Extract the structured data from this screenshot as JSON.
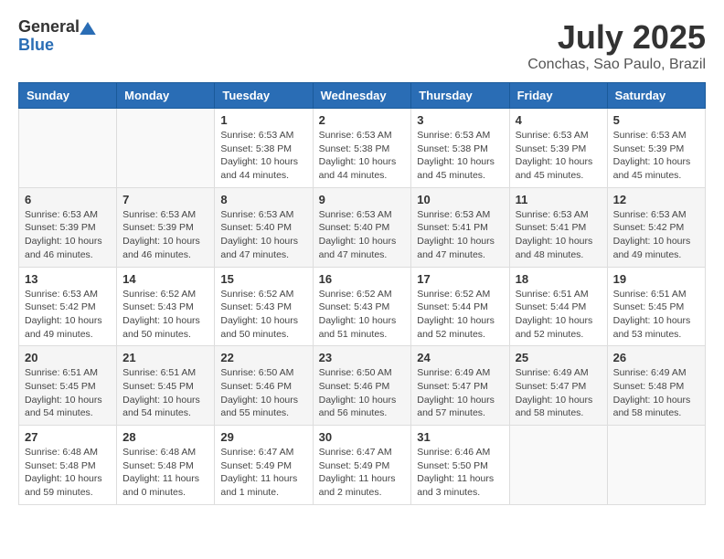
{
  "logo": {
    "general": "General",
    "blue": "Blue"
  },
  "title": {
    "month": "July 2025",
    "location": "Conchas, Sao Paulo, Brazil"
  },
  "weekdays": [
    "Sunday",
    "Monday",
    "Tuesday",
    "Wednesday",
    "Thursday",
    "Friday",
    "Saturday"
  ],
  "weeks": [
    [
      {
        "day": "",
        "info": ""
      },
      {
        "day": "",
        "info": ""
      },
      {
        "day": "1",
        "info": "Sunrise: 6:53 AM\nSunset: 5:38 PM\nDaylight: 10 hours and 44 minutes."
      },
      {
        "day": "2",
        "info": "Sunrise: 6:53 AM\nSunset: 5:38 PM\nDaylight: 10 hours and 44 minutes."
      },
      {
        "day": "3",
        "info": "Sunrise: 6:53 AM\nSunset: 5:38 PM\nDaylight: 10 hours and 45 minutes."
      },
      {
        "day": "4",
        "info": "Sunrise: 6:53 AM\nSunset: 5:39 PM\nDaylight: 10 hours and 45 minutes."
      },
      {
        "day": "5",
        "info": "Sunrise: 6:53 AM\nSunset: 5:39 PM\nDaylight: 10 hours and 45 minutes."
      }
    ],
    [
      {
        "day": "6",
        "info": "Sunrise: 6:53 AM\nSunset: 5:39 PM\nDaylight: 10 hours and 46 minutes."
      },
      {
        "day": "7",
        "info": "Sunrise: 6:53 AM\nSunset: 5:39 PM\nDaylight: 10 hours and 46 minutes."
      },
      {
        "day": "8",
        "info": "Sunrise: 6:53 AM\nSunset: 5:40 PM\nDaylight: 10 hours and 47 minutes."
      },
      {
        "day": "9",
        "info": "Sunrise: 6:53 AM\nSunset: 5:40 PM\nDaylight: 10 hours and 47 minutes."
      },
      {
        "day": "10",
        "info": "Sunrise: 6:53 AM\nSunset: 5:41 PM\nDaylight: 10 hours and 47 minutes."
      },
      {
        "day": "11",
        "info": "Sunrise: 6:53 AM\nSunset: 5:41 PM\nDaylight: 10 hours and 48 minutes."
      },
      {
        "day": "12",
        "info": "Sunrise: 6:53 AM\nSunset: 5:42 PM\nDaylight: 10 hours and 49 minutes."
      }
    ],
    [
      {
        "day": "13",
        "info": "Sunrise: 6:53 AM\nSunset: 5:42 PM\nDaylight: 10 hours and 49 minutes."
      },
      {
        "day": "14",
        "info": "Sunrise: 6:52 AM\nSunset: 5:43 PM\nDaylight: 10 hours and 50 minutes."
      },
      {
        "day": "15",
        "info": "Sunrise: 6:52 AM\nSunset: 5:43 PM\nDaylight: 10 hours and 50 minutes."
      },
      {
        "day": "16",
        "info": "Sunrise: 6:52 AM\nSunset: 5:43 PM\nDaylight: 10 hours and 51 minutes."
      },
      {
        "day": "17",
        "info": "Sunrise: 6:52 AM\nSunset: 5:44 PM\nDaylight: 10 hours and 52 minutes."
      },
      {
        "day": "18",
        "info": "Sunrise: 6:51 AM\nSunset: 5:44 PM\nDaylight: 10 hours and 52 minutes."
      },
      {
        "day": "19",
        "info": "Sunrise: 6:51 AM\nSunset: 5:45 PM\nDaylight: 10 hours and 53 minutes."
      }
    ],
    [
      {
        "day": "20",
        "info": "Sunrise: 6:51 AM\nSunset: 5:45 PM\nDaylight: 10 hours and 54 minutes."
      },
      {
        "day": "21",
        "info": "Sunrise: 6:51 AM\nSunset: 5:45 PM\nDaylight: 10 hours and 54 minutes."
      },
      {
        "day": "22",
        "info": "Sunrise: 6:50 AM\nSunset: 5:46 PM\nDaylight: 10 hours and 55 minutes."
      },
      {
        "day": "23",
        "info": "Sunrise: 6:50 AM\nSunset: 5:46 PM\nDaylight: 10 hours and 56 minutes."
      },
      {
        "day": "24",
        "info": "Sunrise: 6:49 AM\nSunset: 5:47 PM\nDaylight: 10 hours and 57 minutes."
      },
      {
        "day": "25",
        "info": "Sunrise: 6:49 AM\nSunset: 5:47 PM\nDaylight: 10 hours and 58 minutes."
      },
      {
        "day": "26",
        "info": "Sunrise: 6:49 AM\nSunset: 5:48 PM\nDaylight: 10 hours and 58 minutes."
      }
    ],
    [
      {
        "day": "27",
        "info": "Sunrise: 6:48 AM\nSunset: 5:48 PM\nDaylight: 10 hours and 59 minutes."
      },
      {
        "day": "28",
        "info": "Sunrise: 6:48 AM\nSunset: 5:48 PM\nDaylight: 11 hours and 0 minutes."
      },
      {
        "day": "29",
        "info": "Sunrise: 6:47 AM\nSunset: 5:49 PM\nDaylight: 11 hours and 1 minute."
      },
      {
        "day": "30",
        "info": "Sunrise: 6:47 AM\nSunset: 5:49 PM\nDaylight: 11 hours and 2 minutes."
      },
      {
        "day": "31",
        "info": "Sunrise: 6:46 AM\nSunset: 5:50 PM\nDaylight: 11 hours and 3 minutes."
      },
      {
        "day": "",
        "info": ""
      },
      {
        "day": "",
        "info": ""
      }
    ]
  ]
}
